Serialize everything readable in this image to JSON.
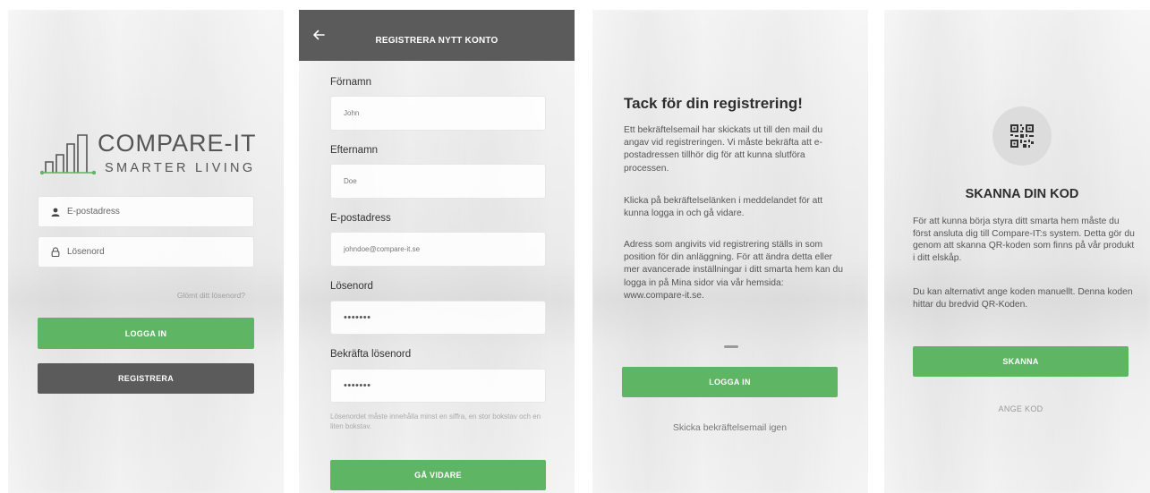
{
  "login": {
    "logo_main": "COMPARE-IT",
    "logo_sub": "SMARTER LIVING",
    "email_placeholder": "E-postadress",
    "password_placeholder": "Lösenord",
    "forgot": "Glömt ditt lösenord?",
    "login_button": "LOGGA IN",
    "register_button": "REGISTRERA"
  },
  "register": {
    "title": "REGISTRERA NYTT KONTO",
    "fields": [
      {
        "label": "Förnamn",
        "value": "John"
      },
      {
        "label": "Efternamn",
        "value": "Doe"
      },
      {
        "label": "E-postadress",
        "value": "johndoe@compare-it.se"
      },
      {
        "label": "Lösenord",
        "value": "•••••••"
      },
      {
        "label": "Bekräfta lösenord",
        "value": "•••••••"
      }
    ],
    "hint": "Lösenordet måste innehålla minst en siffra, en stor bokstav och en liten bokstav.",
    "next_button": "GÅ VIDARE"
  },
  "thanks": {
    "title": "Tack för din registrering!",
    "paragraph1": "Ett bekräftelsemail har skickats ut till den mail du angav vid registreringen. Vi måste bekräfta att e-postadressen tillhör dig för att kunna slutföra processen.",
    "paragraph2": "Klicka på bekräftelselänken i meddelandet för att kunna logga in och gå vidare.",
    "paragraph3": "Adress som angivits vid registrering ställs in som position för din anläggning. För att ändra detta eller mer avancerade inställningar i ditt smarta hem kan du logga in på Mina sidor via vår hemsida: www.compare-it.se.",
    "login_button": "LOGGA IN",
    "resend": "Skicka bekräftelsemail igen"
  },
  "scan": {
    "title": "SKANNA DIN KOD",
    "paragraph1": "För att kunna börja styra ditt smarta hem måste du först ansluta dig till Compare-IT:s system. Detta gör du genom att skanna QR-koden som finns på vår produkt i ditt elskåp.",
    "paragraph2": "Du kan alternativt ange koden manuellt. Denna koden hittar du bredvid QR-Koden.",
    "scan_button": "SKANNA",
    "manual": "ANGE KOD"
  },
  "colors": {
    "green": "#5eb563",
    "dark_gray": "#5b5b5b"
  },
  "icons": [
    "logo-mark-icon",
    "user-icon",
    "lock-icon",
    "back-arrow-icon",
    "qr-code-icon"
  ]
}
